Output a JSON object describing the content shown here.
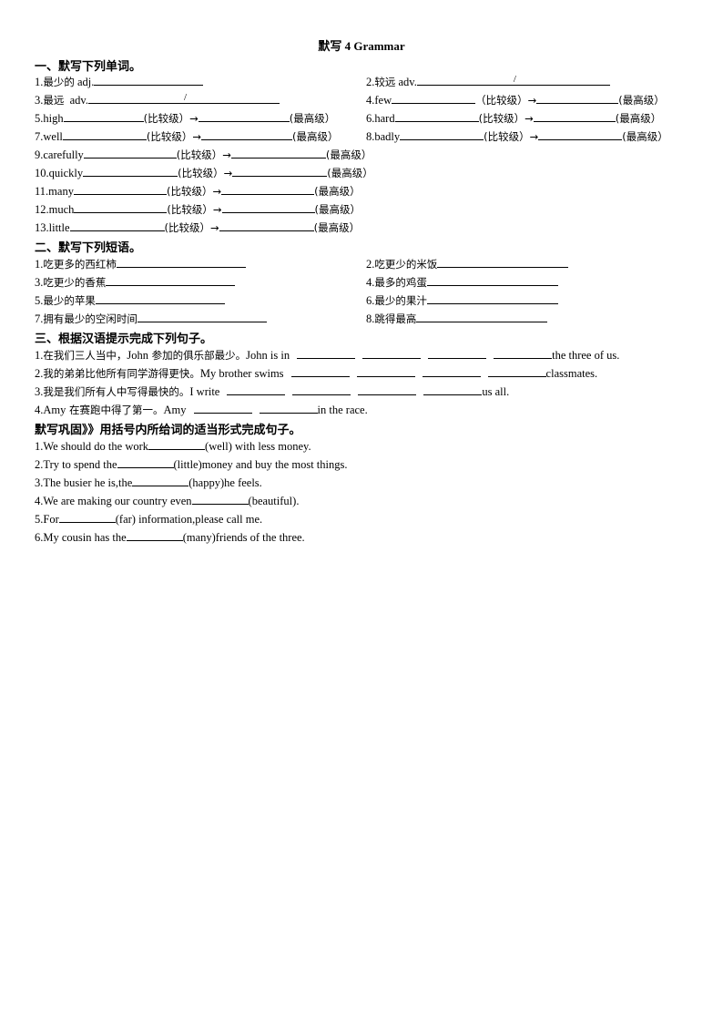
{
  "title": "默写 4 Grammar",
  "section1": {
    "heading": "一、默写下列单词。",
    "comp": "(比较级）→",
    "comp_full": "（比较级）→",
    "sup": "(最高级）",
    "sup_full": "(最高级）",
    "items": [
      {
        "num": "1.",
        "cn": "最少的",
        "en": " adj."
      },
      {
        "num": "2.",
        "cn": "较远",
        "en": " adv."
      },
      {
        "num": "3.",
        "cn": "最远",
        "en": "  adv."
      },
      {
        "num": "4.",
        "en": "few"
      },
      {
        "num": "5.",
        "en": "high"
      },
      {
        "num": "6.",
        "en": "hard"
      },
      {
        "num": "7.",
        "en": "well"
      },
      {
        "num": "8.",
        "en": "badly"
      },
      {
        "num": "9.",
        "en": "carefully"
      },
      {
        "num": "10.",
        "en": "quickly"
      },
      {
        "num": "11.",
        "en": "many"
      },
      {
        "num": "12.",
        "en": "much"
      },
      {
        "num": "13.",
        "en": "little"
      }
    ],
    "slash": "/"
  },
  "section2": {
    "heading": "二、默写下列短语。",
    "items": [
      {
        "num": "1.",
        "cn": "吃更多的西红柿"
      },
      {
        "num": "2.",
        "cn": "吃更少的米饭"
      },
      {
        "num": "3.",
        "cn": "吃更少的香蕉"
      },
      {
        "num": "4.",
        "cn": "最多的鸡蛋"
      },
      {
        "num": "5.",
        "cn": "最少的苹果"
      },
      {
        "num": "6.",
        "cn": "最少的果汁"
      },
      {
        "num": "7.",
        "cn": "拥有最少的空闲时间"
      },
      {
        "num": "8.",
        "cn": "跳得最高"
      }
    ]
  },
  "section3": {
    "heading": "三、根据汉语提示完成下列句子。",
    "items": [
      {
        "num": "1.",
        "cn": "在我们三人当中，",
        "cn_en": "John",
        "cn2": " 参加的俱乐部最少。",
        "en": "John is in",
        "tail": "the three of us."
      },
      {
        "num": "2.",
        "cn": "我的弟弟比他所有同学游得更快。",
        "en": "My brother swims",
        "tail": "classmates."
      },
      {
        "num": "3.",
        "cn": "我是我们所有人中写得最快的。",
        "en": "I write",
        "tail": "us all."
      },
      {
        "num": "4.",
        "cn_en": "Amy",
        "cn": " 在赛跑中得了第一。",
        "en": "Amy",
        "tail": "in the race."
      }
    ]
  },
  "section4": {
    "heading": "默写巩固》》用括号内所给词的适当形式完成句子。",
    "items": [
      {
        "num": "1.",
        "pre": "We should do the work",
        "hint": "(well)",
        "post": " with less money."
      },
      {
        "num": "2.",
        "pre": "Try to spend the",
        "hint": "(little)",
        "post": "money and buy the most things."
      },
      {
        "num": "3.",
        "pre": "The busier he is,the",
        "hint": "(happy)",
        "post": "he feels."
      },
      {
        "num": "4.",
        "pre": "We are making our country even",
        "hint": "(beautiful)",
        "post": "."
      },
      {
        "num": "5.",
        "pre": "For",
        "hint": "(far)",
        "post": " information,please call me."
      },
      {
        "num": "6.",
        "pre": "My cousin has the",
        "hint": "(many)",
        "post": "friends of the three."
      }
    ]
  }
}
